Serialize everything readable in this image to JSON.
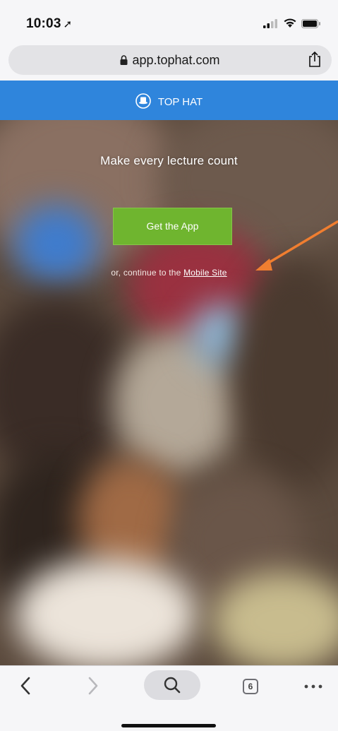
{
  "status_bar": {
    "time": "10:03",
    "location_glyph": "➚",
    "icons": [
      "signal-icon",
      "wifi-icon",
      "battery-icon"
    ]
  },
  "browser": {
    "url": "app.tophat.com",
    "icons": [
      "lock-icon",
      "share-icon"
    ]
  },
  "header": {
    "brand": "TOP HAT",
    "icon": "top-hat-logo-icon",
    "color": "#2f85dc"
  },
  "hero": {
    "title": "Make every lecture count",
    "get_app_label": "Get the App",
    "continue_prefix": "or, continue to the ",
    "mobile_site_link": "Mobile Site",
    "button_color": "#6fb52f",
    "annotation_arrow_color": "#f07e30"
  },
  "toolbar": {
    "tab_count": "6",
    "icons": [
      "back-icon",
      "forward-icon",
      "search-icon",
      "tabs-icon",
      "more-icon"
    ]
  }
}
